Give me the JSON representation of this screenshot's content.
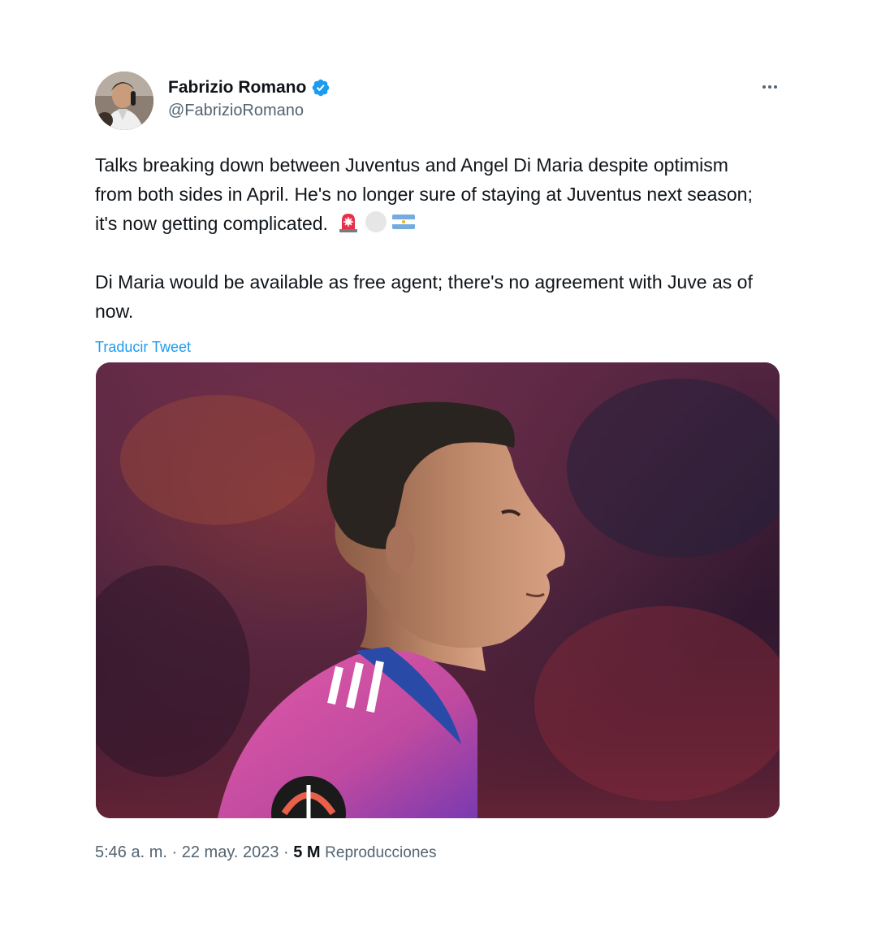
{
  "author": {
    "display_name": "Fabrizio Romano",
    "handle": "@FabrizioRomano",
    "verified": true,
    "avatar_icon": "profile-photo"
  },
  "tweet": {
    "paragraphs": [
      "Talks breaking down between Juventus and Angel Di Maria despite optimism from both sides in April. He's no longer sure of staying at Juventus next season; it's now getting complicated.",
      "Di Maria would be available as free agent; there's no agreement with Juve as of now."
    ],
    "emojis": [
      "siren-emoji",
      "white-circle-emoji",
      "argentina-flag-emoji"
    ],
    "translate_label": "Traducir Tweet"
  },
  "media": {
    "description_icon": "player-photo"
  },
  "meta": {
    "time": "5:46 a. m.",
    "separator": "·",
    "date": "22 may. 2023",
    "views_count": "5 M",
    "views_label": "Reproducciones"
  },
  "colors": {
    "link": "#1d9bf0",
    "secondary_text": "#536471",
    "primary_text": "#0f1419",
    "verified_badge": "#1d9bf0"
  }
}
